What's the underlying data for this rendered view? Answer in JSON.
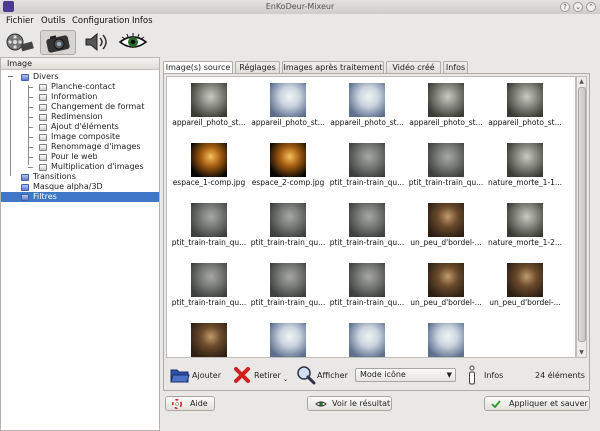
{
  "window": {
    "title": "EnKoDeur-Mixeur"
  },
  "menu": [
    "Fichier",
    "Outils",
    "Configuration",
    "Infos"
  ],
  "toolbar": {
    "icons": [
      "film-reel-icon",
      "camera-icon",
      "audio-icon",
      "eye-icon"
    ],
    "active_index": 1
  },
  "tree": {
    "header": "Image",
    "items": [
      {
        "label": "Divers",
        "level": 0,
        "expanded": true
      },
      {
        "label": "Planche-contact",
        "level": 1
      },
      {
        "label": "Information",
        "level": 1
      },
      {
        "label": "Changement de format",
        "level": 1
      },
      {
        "label": "Redimension",
        "level": 1
      },
      {
        "label": "Ajout d'éléments",
        "level": 1
      },
      {
        "label": "Image composite",
        "level": 1
      },
      {
        "label": "Renommage d'images",
        "level": 1
      },
      {
        "label": "Pour le web",
        "level": 1
      },
      {
        "label": "Multiplication d'images",
        "level": 1
      },
      {
        "label": "Transitions",
        "level": 0
      },
      {
        "label": "Masque alpha/3D",
        "level": 0
      },
      {
        "label": "Filtres",
        "level": 0,
        "selected": true
      }
    ]
  },
  "tabs": [
    "Image(s) source",
    "Réglages",
    "Images après traitement",
    "Vidéo créé",
    "Infos"
  ],
  "active_tab": 0,
  "images": [
    {
      "caption": "appareil_photo_st...",
      "tone": "dark"
    },
    {
      "caption": "appareil_photo_st...",
      "tone": "light"
    },
    {
      "caption": "appareil_photo_st...",
      "tone": "light"
    },
    {
      "caption": "appareil_photo_st...",
      "tone": "dark"
    },
    {
      "caption": "appareil_photo_st...",
      "tone": "dark"
    },
    {
      "caption": "espace_1-comp.jpg",
      "tone": "space"
    },
    {
      "caption": "espace_2-comp.jpg",
      "tone": "space"
    },
    {
      "caption": "ptit_train-train_qu...",
      "tone": "grey"
    },
    {
      "caption": "ptit_train-train_qu...",
      "tone": "grey"
    },
    {
      "caption": "nature_morte_1-1...",
      "tone": "dark"
    },
    {
      "caption": "ptit_train-train_qu...",
      "tone": "grey"
    },
    {
      "caption": "ptit_train-train_qu...",
      "tone": "grey"
    },
    {
      "caption": "ptit_train-train_qu...",
      "tone": "grey"
    },
    {
      "caption": "un_peu_d'bordel-...",
      "tone": "brown"
    },
    {
      "caption": "nature_morte_1-2...",
      "tone": "dark"
    },
    {
      "caption": "ptit_train-train_qu...",
      "tone": "grey"
    },
    {
      "caption": "ptit_train-train_qu...",
      "tone": "grey"
    },
    {
      "caption": "ptit_train-train_qu...",
      "tone": "grey"
    },
    {
      "caption": "un_peu_d'bordel-...",
      "tone": "brown"
    },
    {
      "caption": "un_peu_d'bordel-...",
      "tone": "brown"
    },
    {
      "caption": "",
      "tone": "brown"
    },
    {
      "caption": "",
      "tone": "light"
    },
    {
      "caption": "",
      "tone": "light"
    },
    {
      "caption": "",
      "tone": "light"
    }
  ],
  "actions": {
    "add": "Ajouter",
    "remove": "Retirer",
    "show": "Afficher",
    "mode": "Mode icône",
    "infos": "Infos",
    "count": "24 éléments"
  },
  "bottom": {
    "help": "Aide",
    "result": "Voir le résultat",
    "apply": "Appliquer et sauver"
  },
  "colors": {
    "selection": "#3e78c6",
    "window_bg": "#e9e8e6"
  }
}
